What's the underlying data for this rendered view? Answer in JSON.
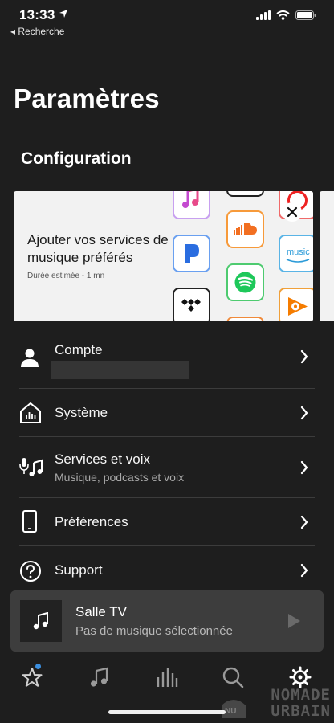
{
  "status_bar": {
    "time": "13:33",
    "back_app": "◂ Recherche"
  },
  "header": {
    "title": "Paramètres"
  },
  "configuration": {
    "title": "Configuration",
    "promo": {
      "title": "Ajouter vos services de musique préférés",
      "subtitle": "Durée estimée - 1 mn",
      "amazon_label": "music"
    }
  },
  "menu": {
    "compte": {
      "label": "Compte"
    },
    "systeme": {
      "label": "Système"
    },
    "services": {
      "label": "Services et voix",
      "subtitle": "Musique, podcasts et voix"
    },
    "preferences": {
      "label": "Préférences"
    },
    "support": {
      "label": "Support"
    }
  },
  "now_playing": {
    "room": "Salle TV",
    "status": "Pas de musique sélectionnée"
  },
  "watermark": {
    "line1": "NOMADE",
    "line2": "URBAIN",
    "badge": "NU"
  },
  "colors": {
    "background": "#1e1e1e",
    "panel": "#3d3d3d",
    "accent_dot": "#3b8fe0"
  },
  "icons": {
    "tabs": [
      "star-icon",
      "music-note-icon",
      "rooms-bars-icon",
      "search-icon",
      "gear-icon"
    ]
  }
}
